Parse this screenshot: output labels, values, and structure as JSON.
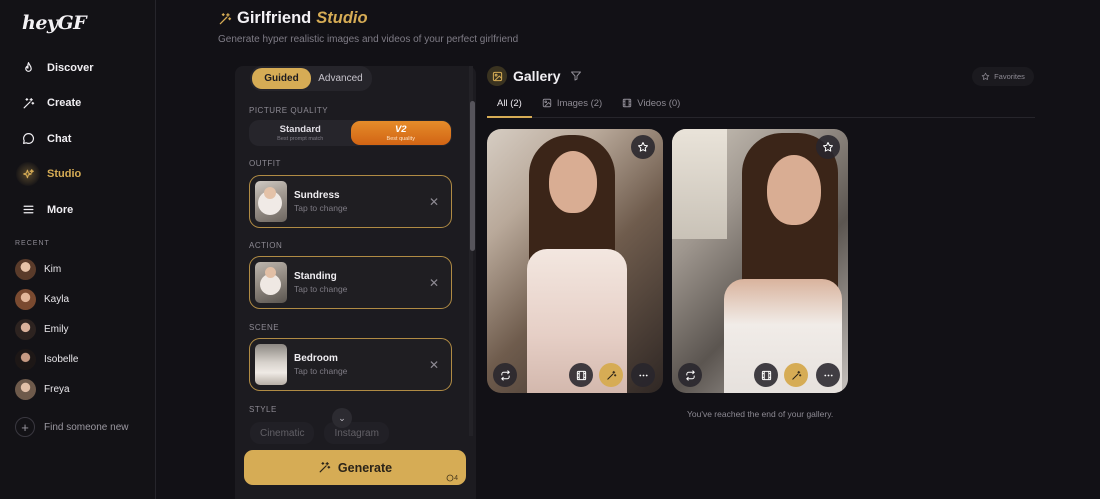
{
  "app": {
    "logo": "heyGF"
  },
  "nav": [
    {
      "label": "Discover",
      "icon": "flame-icon"
    },
    {
      "label": "Create",
      "icon": "magic-wand-icon"
    },
    {
      "label": "Chat",
      "icon": "chat-icon"
    },
    {
      "label": "Studio",
      "icon": "sparkles-icon",
      "active": true
    },
    {
      "label": "More",
      "icon": "menu-icon"
    }
  ],
  "recent": {
    "label": "RECENT",
    "items": [
      "Kim",
      "Kayla",
      "Emily",
      "Isobelle",
      "Freya"
    ],
    "find_label": "Find someone new"
  },
  "header": {
    "title": "Girlfriend",
    "title_accent": "Studio",
    "subtitle": "Generate hyper realistic images and videos of your perfect girlfriend"
  },
  "panel": {
    "modes": [
      "Guided",
      "Advanced"
    ],
    "active_mode": "Guided",
    "quality_label": "PICTURE QUALITY",
    "quality": [
      {
        "title": "Standard",
        "sub": "Best prompt match"
      },
      {
        "title": "V2",
        "sub": "Best quality",
        "active": true
      }
    ],
    "outfit": {
      "label": "OUTFIT",
      "title": "Sundress",
      "sub": "Tap to change"
    },
    "action": {
      "label": "ACTION",
      "title": "Standing",
      "sub": "Tap to change"
    },
    "scene": {
      "label": "SCENE",
      "title": "Bedroom",
      "sub": "Tap to change"
    },
    "style_label": "STYLE",
    "styles": [
      "Cinematic",
      "Instagram"
    ],
    "generate_label": "Generate",
    "generate_count": "4"
  },
  "gallery": {
    "title": "Gallery",
    "favorites_label": "Favorites",
    "tabs": [
      "All (2)",
      "Images (2)",
      "Videos (0)"
    ],
    "active_tab": "All (2)",
    "end_text": "You've reached the end of your gallery."
  },
  "colors": {
    "accent": "#d6ac55",
    "v2": "#e07a20",
    "background": "#121116"
  }
}
